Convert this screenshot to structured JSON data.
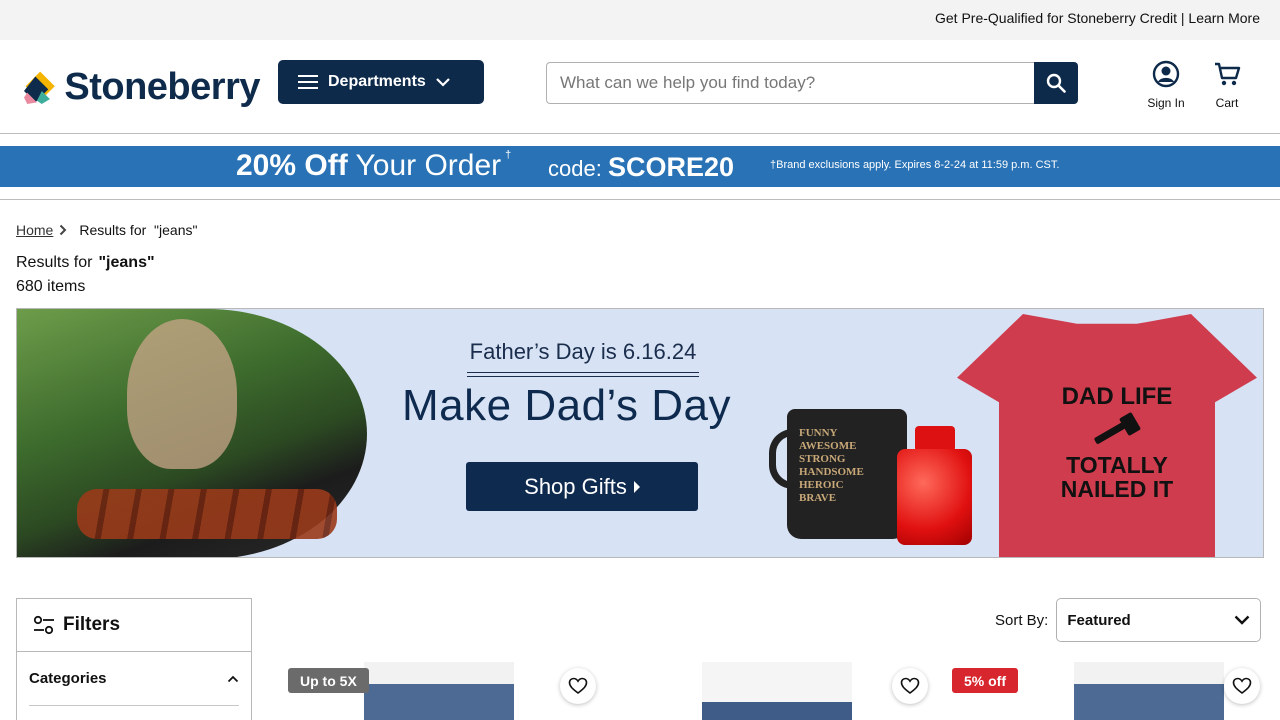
{
  "topbar": {
    "prequal_text": "Get Pre-Qualified for Stoneberry Credit",
    "separator": " | ",
    "learn_more": "Learn More"
  },
  "header": {
    "brand": "Stoneberry",
    "departments_label": "Departments",
    "search_placeholder": "What can we help you find today?",
    "sign_in_label": "Sign In",
    "cart_label": "Cart"
  },
  "promo": {
    "headline_bold": "20% Off",
    "headline_rest": "Your Order",
    "dagger": "†",
    "code_label": "code:",
    "code": "SCORE20",
    "fine_print": "†Brand exclusions apply. Expires 8-2-24 at 11:59 p.m. CST."
  },
  "breadcrumb": {
    "home": "Home",
    "current": "Results for  \"jeans\""
  },
  "results": {
    "prefix": "Results for",
    "query": "\"jeans\"",
    "count": "680 items"
  },
  "banner": {
    "date_text": "Father’s Day is 6.16.24",
    "headline": "Make Dad’s Day",
    "cta": "Shop Gifts",
    "mug_words": [
      "FUNNY",
      "AWESOME",
      "STRONG",
      "HANDSOME",
      "HEROIC",
      "BRAVE"
    ],
    "shirt_line1": "DAD LIFE",
    "shirt_line2": "TOTALLY",
    "shirt_line3": "NAILED IT"
  },
  "filters": {
    "title": "Filters",
    "categories_label": "Categories"
  },
  "sort": {
    "label": "Sort By:",
    "selected": "Featured"
  },
  "products": [
    {
      "badge": "Up to 5X",
      "badge_color": "#6b6b6b"
    },
    {
      "badge": "",
      "badge_color": ""
    },
    {
      "badge": "5% off",
      "badge_color": "#d7262d"
    }
  ],
  "colors": {
    "navy": "#0d2a4b",
    "promo_blue": "#2872b5",
    "accent_teal": "#3fae9d",
    "accent_yellow": "#f4b400",
    "accent_pink": "#e98aa0"
  }
}
